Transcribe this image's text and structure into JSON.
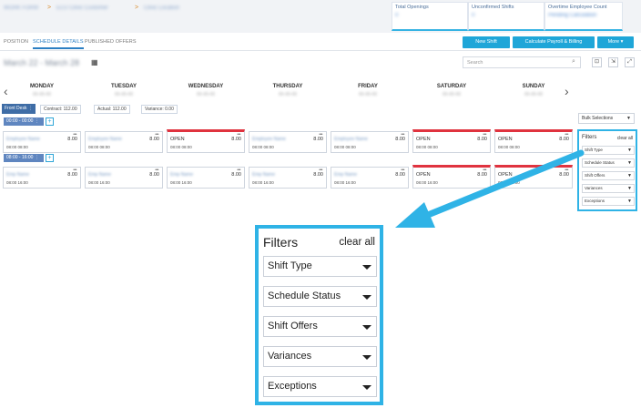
{
  "breadcrumb": [
    "WORK FORM",
    "ECU Clinic Customer",
    "Clinic Location"
  ],
  "stats": [
    {
      "label": "Total Openings",
      "value": "0"
    },
    {
      "label": "Unconfirmed Shifts",
      "value": "0"
    },
    {
      "label": "Overtime Employee Count",
      "value": "Pending Calculation"
    }
  ],
  "tabs": [
    "POSITION",
    "SCHEDULE DETAILS",
    "PUBLISHED OFFERS"
  ],
  "actions": {
    "new_shift": "New Shift",
    "calculate": "Calculate Payroll & Billing",
    "more": "More ▾"
  },
  "date_range": "March 22 - March 28",
  "search_placeholder": "Search",
  "days": [
    {
      "name": "MONDAY",
      "sub": "00-00-00"
    },
    {
      "name": "TUESDAY",
      "sub": "00-00-00"
    },
    {
      "name": "WEDNESDAY",
      "sub": "00-00-00"
    },
    {
      "name": "THURSDAY",
      "sub": "00-00-00"
    },
    {
      "name": "FRIDAY",
      "sub": "00-00-00"
    },
    {
      "name": "SATURDAY",
      "sub": "00-00-00"
    },
    {
      "name": "SUNDAY",
      "sub": "00-00-00"
    }
  ],
  "front_desk": "Front Desk ⋮",
  "contract": "Contract: 112.00",
  "actual": "Actual: 112.00",
  "variance": "Variance: 0.00",
  "time_groups": [
    "00:00 - 00:00 ⋮",
    "08:00 - 16:00 ⋮"
  ],
  "row1": [
    {
      "kind": "name",
      "label": "Employee Name",
      "hours": "8.00",
      "times": "08:00  08:00"
    },
    {
      "kind": "name",
      "label": "Employee Name",
      "hours": "8.00",
      "times": "08:00  08:00"
    },
    {
      "kind": "open",
      "label": "OPEN",
      "hours": "8.00",
      "times": "08:00  08:00"
    },
    {
      "kind": "name",
      "label": "Employee Name",
      "hours": "8.00",
      "times": "08:00  08:00"
    },
    {
      "kind": "name",
      "label": "Employee Name",
      "hours": "8.00",
      "times": "08:00  08:00"
    },
    {
      "kind": "open",
      "label": "OPEN",
      "hours": "8.00",
      "times": "08:00  08:00"
    },
    {
      "kind": "open",
      "label": "OPEN",
      "hours": "8.00",
      "times": "08:00  08:00"
    }
  ],
  "row2": [
    {
      "kind": "name",
      "label": "Emp Name",
      "hours": "8.00",
      "times": "08:00  16:00"
    },
    {
      "kind": "name",
      "label": "Emp Name",
      "hours": "8.00",
      "times": "08:00  16:00"
    },
    {
      "kind": "name",
      "label": "Emp Name",
      "hours": "8.00",
      "times": "08:00  16:00"
    },
    {
      "kind": "name",
      "label": "Emp Name",
      "hours": "8.00",
      "times": "08:00  16:00"
    },
    {
      "kind": "name",
      "label": "Emp Name",
      "hours": "8.00",
      "times": "08:00  16:00"
    },
    {
      "kind": "open",
      "label": "OPEN",
      "hours": "8.00",
      "times": "08:00  16:00"
    },
    {
      "kind": "open",
      "label": "OPEN",
      "hours": "8.00",
      "times": "08:00  16:00"
    }
  ],
  "bulk": "Bulk Selections",
  "filters": {
    "title": "Filters",
    "clear": "clear all",
    "items": [
      "Shift Type",
      "Schedule Status",
      "Shift Offers",
      "Variances",
      "Exceptions"
    ]
  },
  "colors": {
    "accent": "#2fb3e6",
    "open_red": "#e0333f",
    "button": "#1fa6d8"
  }
}
